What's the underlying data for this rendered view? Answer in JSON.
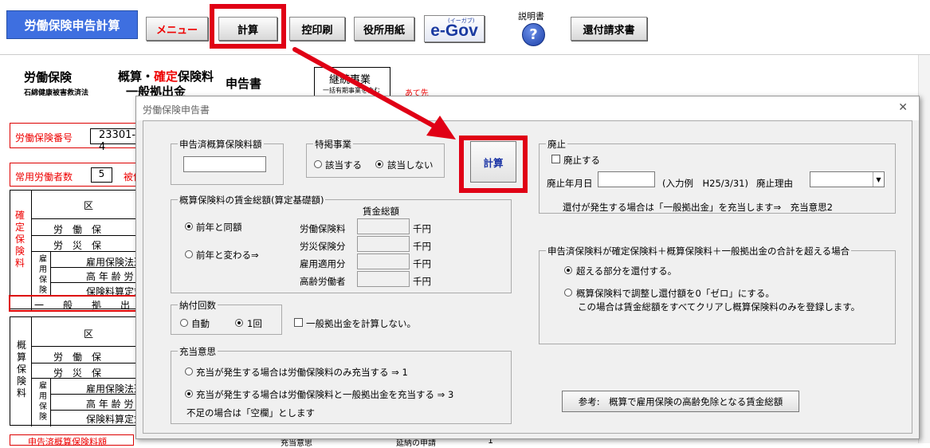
{
  "toolbar": {
    "app_title": "労働保険申告計算",
    "menu": "メニュー",
    "calc": "計算",
    "hikae": "控印刷",
    "yakusho": "役所用紙",
    "egov_logo": "e-Gov",
    "egov_sub": "(イーガブ)",
    "help_label": "説明書",
    "help_glyph": "?",
    "refund": "還付請求書"
  },
  "background": {
    "title_a": "労働保険",
    "title_a_sub": "石綿健康被害救済法",
    "title_b1": "概算・",
    "title_b2": "確定",
    "title_b3": "保険料",
    "title_b4": "一般拠出金",
    "title_c": "申告書",
    "keizoku": "継続事業",
    "keizoku_sub": "一括有期事業を含む",
    "atesaki": "あて先",
    "bango_label": "労働保険番号",
    "bango_value": "23301-4",
    "joyo_label": "常用労働者数",
    "joyo_value": "5",
    "hi_label": "被保",
    "kakutei_vertical": "確定保険料",
    "gaisan_vertical": "概算保険料",
    "ku": "区",
    "rows1": [
      "労　働　保",
      "労　災　保"
    ],
    "koyo_vertical": "雇用保険",
    "subrows1": [
      "雇用保険法適",
      "高 年 齢 労 働",
      "保険料算定対"
    ],
    "ippan_row": "一　　般　　拠　　出",
    "rows2": [
      "労　働　保",
      "労　災　保"
    ],
    "subrows2": [
      "雇用保険法適",
      "高 年 齢 労 働",
      "保険料算定対"
    ],
    "bottom_label": "申告済概算保険料額",
    "bottom_mid": "充当意思",
    "bottom_right": "延納の申請",
    "bottom_right_value": "1"
  },
  "dialog": {
    "title": "労働保険申告書",
    "close_glyph": "✕",
    "shinkoku_group": "申告済概算保険料額",
    "tokkei_group": "特掲事業",
    "tokkei_yes": "該当する",
    "tokkei_no": "該当しない",
    "calc_button": "計算",
    "chingin_group": "概算保険料の賃金総額(算定基礎額)",
    "opt_same": "前年と同額",
    "opt_change": "前年と変わる⇒",
    "chingin_header": "賃金総額",
    "rows": [
      "労働保険料",
      "労災保険分",
      "雇用適用分",
      "高齢労働者"
    ],
    "unit": "千円",
    "nofu_group": "納付回数",
    "nofu_auto": "自動",
    "nofu_once": "1回",
    "ippan_check": "一般拠出金を計算しない。",
    "juto_group": "充当意思",
    "juto_opt1": "充当が発生する場合は労働保険料のみ充当する ⇒ 1",
    "juto_opt2": "充当が発生する場合は労働保険料と一般拠出金を充当する ⇒ 3",
    "juto_note": "不足の場合は「空欄」とします",
    "haishi_group": "廃止",
    "haishi_check": "廃止する",
    "haishi_date_label": "廃止年月日",
    "haishi_example": "(入力例　H25/3/31)",
    "haishi_reason_label": "廃止理由",
    "select_arrow": "▼",
    "kanpu_note": "還付が発生する場合は「一般拠出金」を充当します⇒　充当意思2",
    "exceed_group": "申告済保険料が確定保険料＋概算保険料＋一般拠出金の合計を超える場合",
    "exceed_opt1": "超える部分を還付する。",
    "exceed_opt2": "概算保険料で調整し還付額を0「ゼロ」にする。",
    "exceed_opt2_note": "この場合は賃金総額をすべてクリアし概算保険料のみを登録します。",
    "ref_button": "参考:　概算で雇用保険の高齢免除となる賃金総額"
  }
}
